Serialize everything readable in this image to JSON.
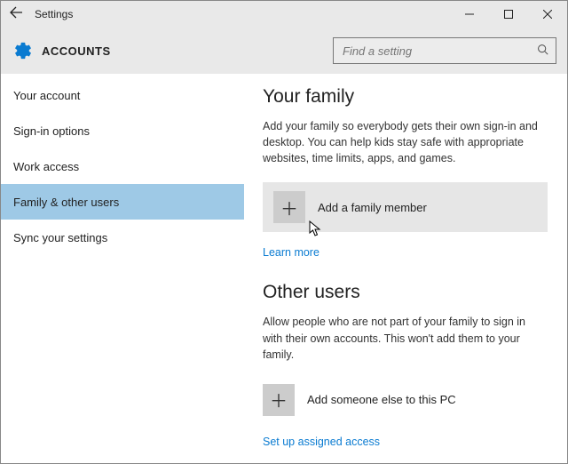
{
  "window": {
    "title": "Settings"
  },
  "header": {
    "title": "ACCOUNTS",
    "search_placeholder": "Find a setting"
  },
  "sidebar": {
    "items": [
      {
        "label": "Your account",
        "selected": false
      },
      {
        "label": "Sign-in options",
        "selected": false
      },
      {
        "label": "Work access",
        "selected": false
      },
      {
        "label": "Family & other users",
        "selected": true
      },
      {
        "label": "Sync your settings",
        "selected": false
      }
    ]
  },
  "content": {
    "family": {
      "title": "Your family",
      "description": "Add your family so everybody gets their own sign-in and desktop. You can help kids stay safe with appropriate websites, time limits, apps, and games.",
      "add_label": "Add a family member",
      "learn_more": "Learn more"
    },
    "other": {
      "title": "Other users",
      "description": "Allow people who are not part of your family to sign in with their own accounts. This won't add them to your family.",
      "add_label": "Add someone else to this PC",
      "assigned_access": "Set up assigned access"
    }
  }
}
